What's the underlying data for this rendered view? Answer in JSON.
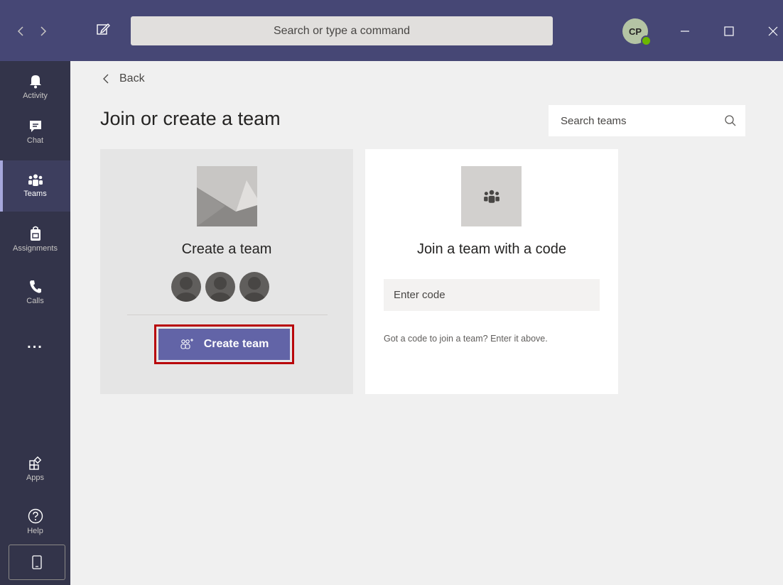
{
  "titlebar": {
    "search_placeholder": "Search or type a command",
    "avatar_initials": "CP",
    "accent": "#464775"
  },
  "rail": {
    "items": [
      {
        "label": "Activity",
        "icon": "bell-icon"
      },
      {
        "label": "Chat",
        "icon": "chat-icon"
      },
      {
        "label": "Teams",
        "icon": "teams-icon",
        "active": true
      },
      {
        "label": "Assignments",
        "icon": "assignments-icon"
      },
      {
        "label": "Calls",
        "icon": "phone-icon"
      },
      {
        "label": "...",
        "icon": "more-icon"
      },
      {
        "label": "Apps",
        "icon": "apps-icon"
      },
      {
        "label": "Help",
        "icon": "help-icon"
      }
    ]
  },
  "main": {
    "back_label": "Back",
    "title": "Join or create a team",
    "search_teams_placeholder": "Search teams"
  },
  "create_card": {
    "title": "Create a team",
    "button_label": "Create team",
    "button_color": "#6264a7",
    "highlight_color": "#b8040a"
  },
  "join_card": {
    "title": "Join a team with a code",
    "code_placeholder": "Enter code",
    "hint": "Got a code to join a team? Enter it above."
  }
}
